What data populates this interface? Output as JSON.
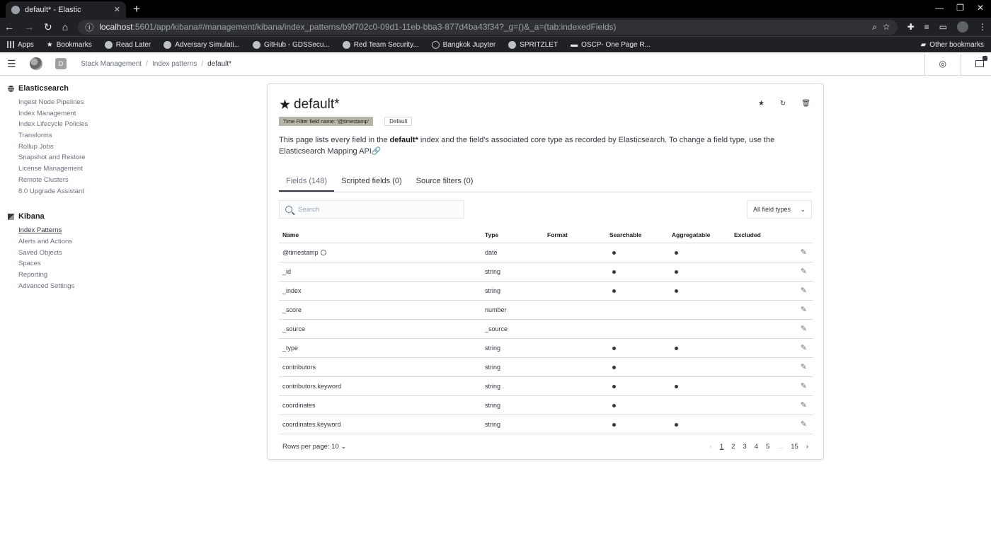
{
  "browser": {
    "tab_title": "default* - Elastic",
    "url_host": "localhost",
    "url_path": ":5601/app/kibana#/management/kibana/index_patterns/b9f702c0-09d1-11eb-bba3-877d4ba43f34?_g=()&_a=(tab:indexedFields)",
    "bookmarks": [
      "Apps",
      "Bookmarks",
      "Read Later",
      "Adversary Simulati...",
      "GitHub - GDSSecu...",
      "Red Team Security...",
      "Bangkok Jupyter",
      "SPRITZLET",
      "OSCP- One Page R..."
    ],
    "other_bookmarks": "Other bookmarks"
  },
  "header": {
    "space_letter": "D",
    "breadcrumbs": [
      "Stack Management",
      "Index patterns",
      "default*"
    ]
  },
  "sidebar": {
    "sections": [
      {
        "title": "Elasticsearch",
        "items": [
          "Ingest Node Pipelines",
          "Index Management",
          "Index Lifecycle Policies",
          "Transforms",
          "Rollup Jobs",
          "Snapshot and Restore",
          "License Management",
          "Remote Clusters",
          "8.0 Upgrade Assistant"
        ]
      },
      {
        "title": "Kibana",
        "items": [
          "Index Patterns",
          "Alerts and Actions",
          "Saved Objects",
          "Spaces",
          "Reporting",
          "Advanced Settings"
        ]
      }
    ]
  },
  "page": {
    "title": "default*",
    "time_filter_badge": "Time Filter field name: '@timestamp'",
    "default_badge": "Default",
    "desc_1": "This page lists every field in the ",
    "desc_bold": "default*",
    "desc_2": " index and the field's associated core type as recorded by Elasticsearch. To change a field type, use the Elasticsearch ",
    "desc_link": "Mapping API",
    "tabs": [
      "Fields (148)",
      "Scripted fields (0)",
      "Source filters (0)"
    ],
    "search_placeholder": "Search",
    "type_filter": "All field types",
    "columns": [
      "Name",
      "Type",
      "Format",
      "Searchable",
      "Aggregatable",
      "Excluded"
    ],
    "rows": [
      {
        "name": "@timestamp",
        "type": "date",
        "searchable": true,
        "aggregatable": true,
        "clock": true
      },
      {
        "name": "_id",
        "type": "string",
        "searchable": true,
        "aggregatable": true
      },
      {
        "name": "_index",
        "type": "string",
        "searchable": true,
        "aggregatable": true
      },
      {
        "name": "_score",
        "type": "number",
        "searchable": false,
        "aggregatable": false
      },
      {
        "name": "_source",
        "type": "_source",
        "searchable": false,
        "aggregatable": false
      },
      {
        "name": "_type",
        "type": "string",
        "searchable": true,
        "aggregatable": true
      },
      {
        "name": "contributors",
        "type": "string",
        "searchable": true,
        "aggregatable": false
      },
      {
        "name": "contributors.keyword",
        "type": "string",
        "searchable": true,
        "aggregatable": true
      },
      {
        "name": "coordinates",
        "type": "string",
        "searchable": true,
        "aggregatable": false
      },
      {
        "name": "coordinates.keyword",
        "type": "string",
        "searchable": true,
        "aggregatable": true
      }
    ],
    "rows_per_page": "Rows per page: 10",
    "pages": [
      "1",
      "2",
      "3",
      "4",
      "5",
      "...",
      "15"
    ],
    "current_page": "1"
  }
}
